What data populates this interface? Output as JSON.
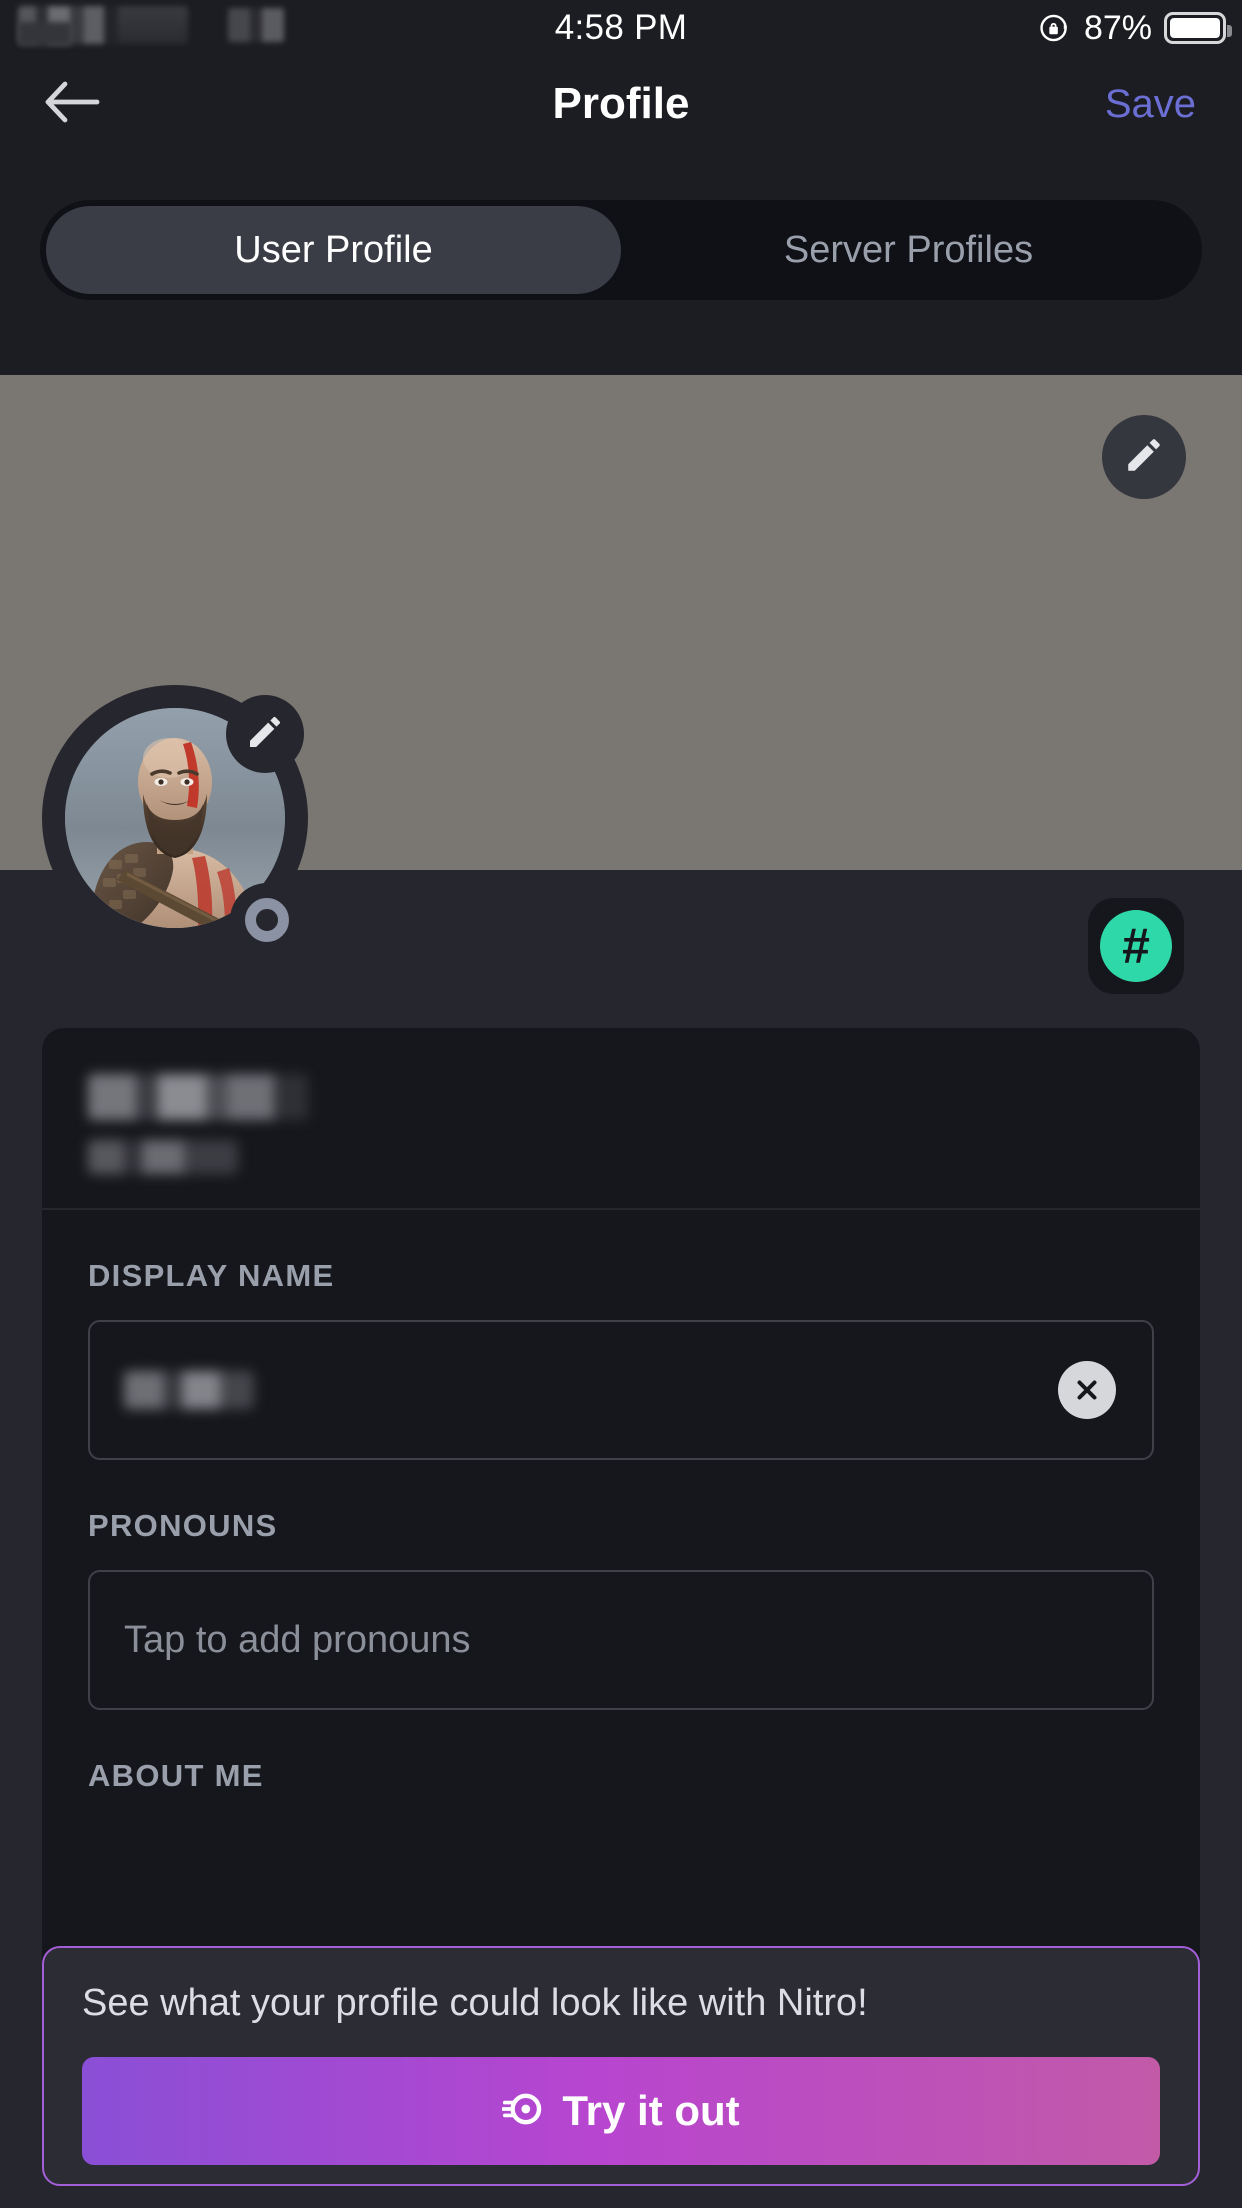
{
  "status_bar": {
    "time": "4:58 PM",
    "battery_percent": "87%",
    "rotation_lock_icon": "rotation-lock-icon",
    "battery_icon": "battery-icon"
  },
  "nav": {
    "back_icon": "back-arrow-icon",
    "title": "Profile",
    "save_label": "Save"
  },
  "tabs": [
    {
      "label": "User Profile",
      "active": true
    },
    {
      "label": "Server Profiles",
      "active": false
    }
  ],
  "banner": {
    "edit_icon": "pencil-icon",
    "color": "#7a7672"
  },
  "avatar": {
    "edit_icon": "pencil-icon",
    "status_icon": "idle-status-icon",
    "description": "kratos-avatar"
  },
  "hash_badge": {
    "icon": "hash-icon",
    "symbol": "#",
    "accent": "#2fd8a8"
  },
  "card": {
    "username_hidden": true,
    "tag_hidden": true,
    "fields": [
      {
        "label": "DISPLAY NAME",
        "value_hidden": true,
        "clear_icon": "clear-x-icon",
        "placeholder": ""
      },
      {
        "label": "PRONOUNS",
        "value_hidden": false,
        "placeholder": "Tap to add pronouns"
      },
      {
        "label": "ABOUT ME",
        "value_hidden": false,
        "placeholder": ""
      }
    ]
  },
  "nitro": {
    "text": "See what your profile could look like with Nitro!",
    "button_label": "Try it out",
    "button_icon": "nitro-wheel-icon",
    "border_color": "#a45fd8",
    "gradient_start": "#8a4fd6",
    "gradient_end": "#c25aa8"
  }
}
